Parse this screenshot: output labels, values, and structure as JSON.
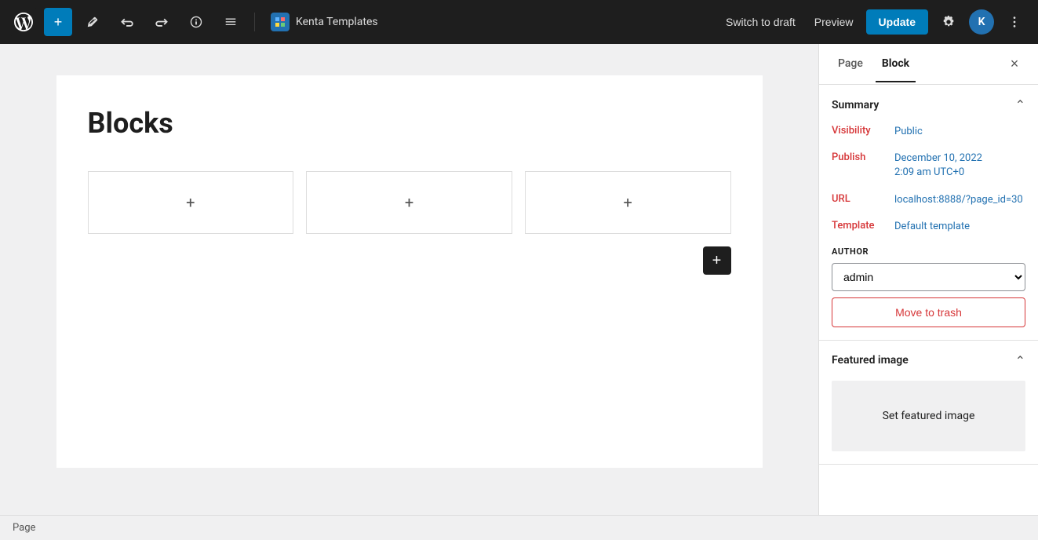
{
  "topbar": {
    "wp_logo_alt": "WordPress",
    "add_label": "+",
    "edit_label": "✎",
    "undo_label": "↩",
    "redo_label": "↪",
    "info_label": "ⓘ",
    "list_label": "≡",
    "plugin_name": "Kenta Templates",
    "switch_to_draft_label": "Switch to draft",
    "preview_label": "Preview",
    "update_label": "Update",
    "settings_label": "⚙",
    "avatar_label": "K",
    "more_label": "⋮"
  },
  "canvas": {
    "page_title": "Blocks",
    "block1_plus": "+",
    "block2_plus": "+",
    "block3_plus": "+",
    "add_block_plus": "+"
  },
  "sidebar": {
    "tab_page": "Page",
    "tab_block": "Block",
    "close_label": "×",
    "summary_title": "Summary",
    "visibility_label": "Visibility",
    "visibility_value": "Public",
    "publish_label": "Publish",
    "publish_value": "December 10, 2022\n2:09 am UTC+0",
    "publish_line1": "December 10, 2022",
    "publish_line2": "2:09 am UTC+0",
    "url_label": "URL",
    "url_value": "localhost:8888/?page_id=30",
    "template_label": "Template",
    "template_value": "Default template",
    "author_label": "AUTHOR",
    "author_value": "admin",
    "author_options": [
      "admin"
    ],
    "move_to_trash_label": "Move to trash",
    "featured_image_title": "Featured image",
    "set_featured_image_label": "Set featured image"
  },
  "bottombar": {
    "label": "Page"
  },
  "colors": {
    "accent_blue": "#2271b1",
    "danger_red": "#d63638",
    "update_blue": "#007cba"
  }
}
